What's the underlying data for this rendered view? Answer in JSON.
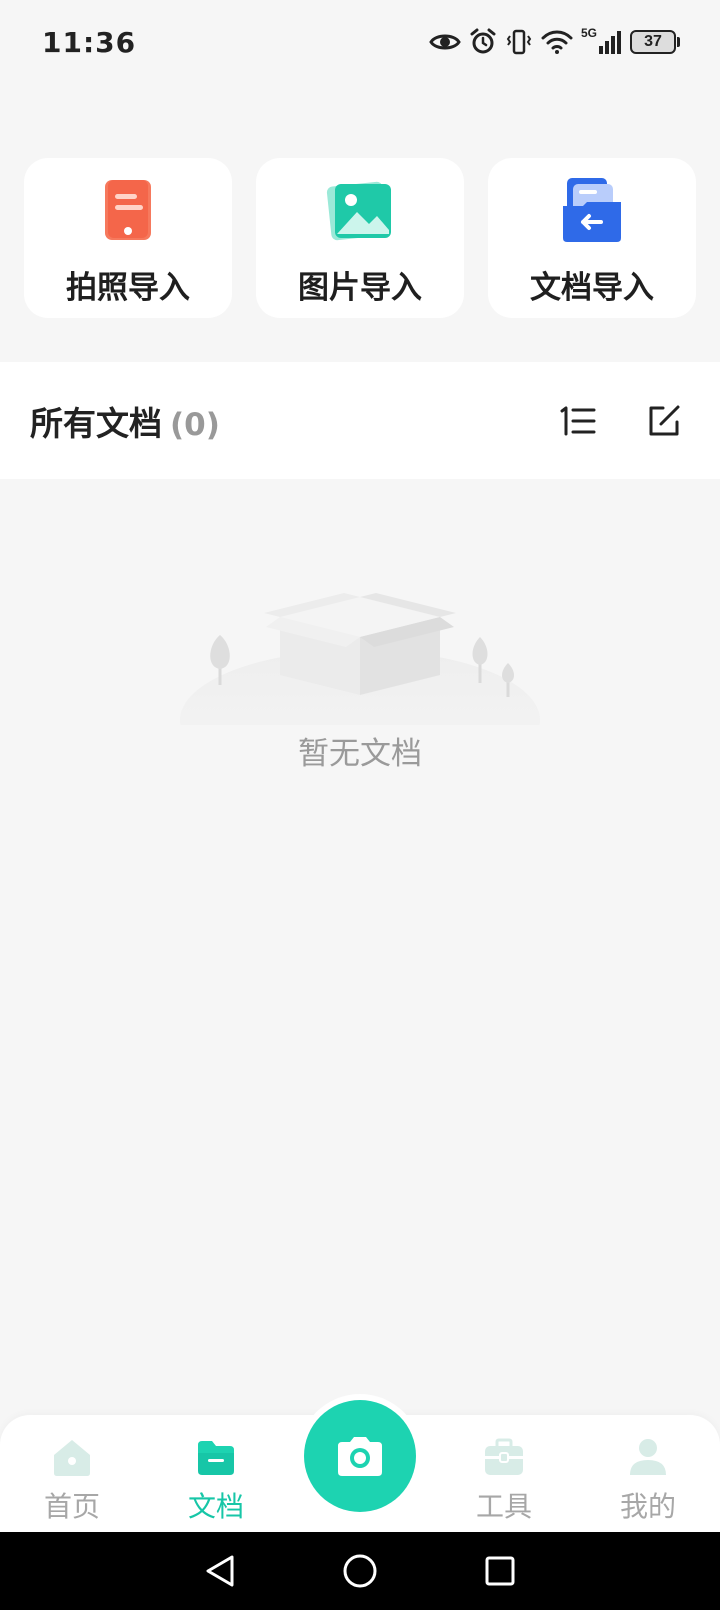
{
  "status_bar": {
    "time": "11:36",
    "battery": "37",
    "network": "5G",
    "icons": [
      "eye-icon",
      "alarm-icon",
      "vibrate-icon",
      "wifi-icon",
      "signal-icon",
      "battery-icon"
    ]
  },
  "import_actions": [
    {
      "label": "拍照导入",
      "icon": "phone-document-icon",
      "color": "#f4664a"
    },
    {
      "label": "图片导入",
      "icon": "image-icon",
      "color": "#1fc9a8"
    },
    {
      "label": "文档导入",
      "icon": "folder-import-icon",
      "color": "#2f6ae8"
    }
  ],
  "documents": {
    "title": "所有文档",
    "count": "(0)",
    "sort_icon": "sort-list-icon",
    "edit_icon": "edit-icon",
    "empty_text": "暂无文档"
  },
  "bottom_nav": {
    "items": [
      {
        "label": "首页",
        "icon": "home-icon",
        "active": false
      },
      {
        "label": "文档",
        "icon": "folder-icon",
        "active": true
      },
      {
        "label": "工具",
        "icon": "toolbox-icon",
        "active": false
      },
      {
        "label": "我的",
        "icon": "user-icon",
        "active": false
      }
    ],
    "fab_icon": "camera-icon"
  },
  "colors": {
    "accent": "#1dd3b1",
    "active_label": "#17c6a7",
    "inactive": "#a7a7a7",
    "background": "#f6f6f6"
  }
}
